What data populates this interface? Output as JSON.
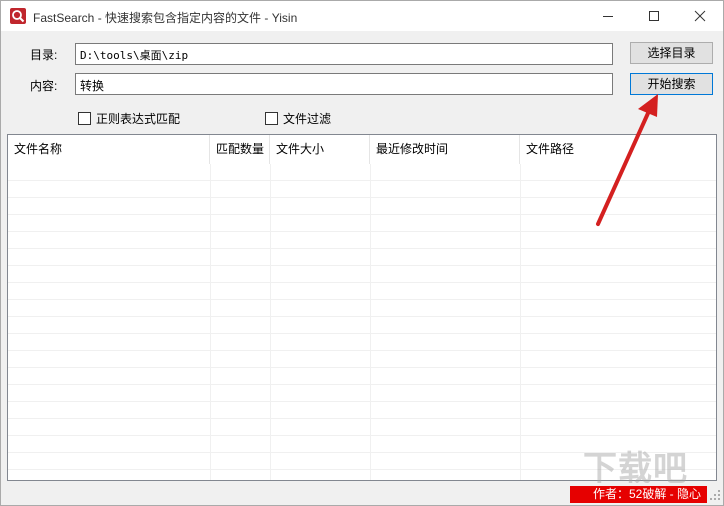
{
  "window": {
    "title": "FastSearch - 快速搜索包含指定内容的文件 - Yisin"
  },
  "form": {
    "dir_label": "目录:",
    "dir_value": "D:\\tools\\桌面\\zip",
    "content_label": "内容:",
    "content_value": "转换",
    "select_dir_button": "选择目录",
    "start_search_button": "开始搜索",
    "regex_checkbox_label": "正则表达式匹配",
    "filter_checkbox_label": "文件过滤"
  },
  "table": {
    "columns": [
      "文件名称",
      "匹配数量",
      "文件大小",
      "最近修改时间",
      "文件路径"
    ],
    "rows": []
  },
  "status": {
    "author_text": "作者：52破解 - 隐心"
  },
  "watermark": {
    "text": "下载吧"
  },
  "colors": {
    "app_icon": "#c0262d",
    "status_highlight": "#e60000",
    "annotation_arrow": "#d42020"
  }
}
